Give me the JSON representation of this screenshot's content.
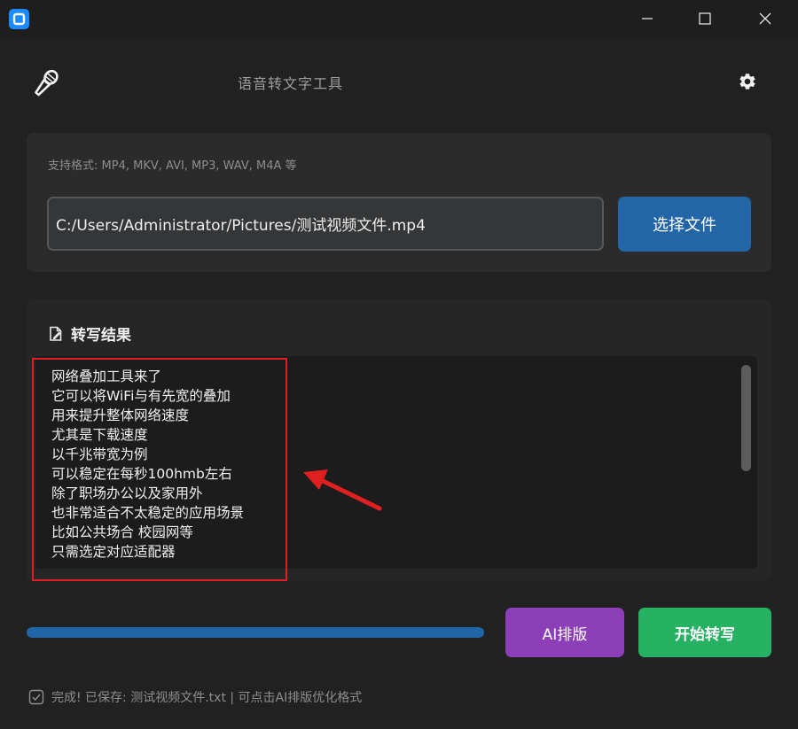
{
  "app": {
    "title": "语音转文字工具"
  },
  "file": {
    "formats_hint": "支持格式: MP4, MKV, AVI, MP3, WAV, M4A 等",
    "path": "C:/Users/Administrator/Pictures/测试视频文件.mp4",
    "choose_label": "选择文件"
  },
  "result": {
    "title": "转写结果",
    "lines": [
      "网络叠加工具来了",
      "它可以将WiFi与有先宽的叠加",
      "用来提升整体网络速度",
      "尤其是下载速度",
      "以千兆带宽为例",
      "可以稳定在每秒100hmb左右",
      "除了职场办公以及家用外",
      "也非常适合不太稳定的应用场景",
      "比如公共场合 校园网等",
      "只需选定对应适配器"
    ]
  },
  "actions": {
    "ai_label": "AI排版",
    "start_label": "开始转写"
  },
  "progress": {
    "value": 1.0
  },
  "status": {
    "text": "完成! 已保存: 测试视频文件.txt | 可点击AI排版优化格式"
  },
  "colors": {
    "background": "#212121",
    "primary_blue": "#2366a8",
    "ai_purple": "#8d3fb8",
    "start_green": "#27b163",
    "highlight_red": "#e02020"
  },
  "icons": {
    "app": "app-logo-icon",
    "header": "microphone-icon",
    "settings": "gear-icon",
    "result": "edit-document-icon",
    "status": "checkbox-check-icon"
  }
}
